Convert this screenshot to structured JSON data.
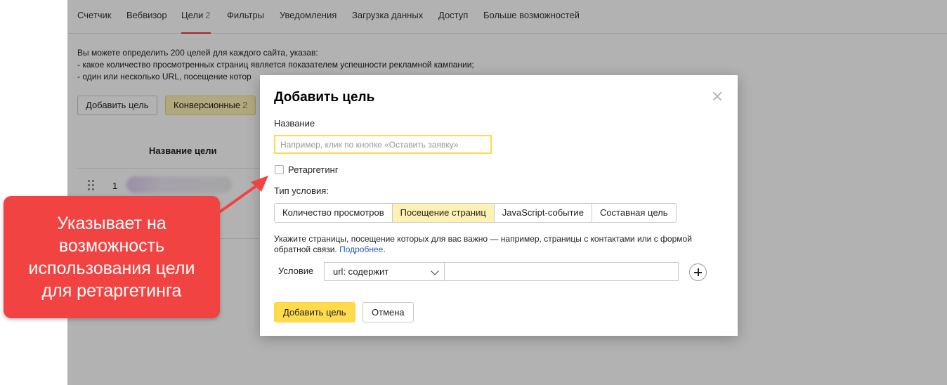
{
  "tabs": [
    {
      "label": "Счетчик"
    },
    {
      "label": "Вебвизор"
    },
    {
      "label": "Цели",
      "count": "2"
    },
    {
      "label": "Фильтры"
    },
    {
      "label": "Уведомления"
    },
    {
      "label": "Загрузка данных"
    },
    {
      "label": "Доступ"
    },
    {
      "label": "Больше возможностей"
    }
  ],
  "intro": {
    "line1": "Вы можете определить 200 целей для каждого сайта, указав:",
    "line2": "-  какое количество просмотренных страниц является показателем успешности рекламной кампании;",
    "line3": "-  один или несколько URL, посещение котор"
  },
  "page_buttons": {
    "add_goal": "Добавить цель",
    "conversion": "Конверсионные",
    "conversion_count": "2"
  },
  "table": {
    "header_name": "Название цели",
    "rows": [
      {
        "num": "1"
      }
    ]
  },
  "modal": {
    "title": "Добавить цель",
    "name_label": "Название",
    "name_placeholder": "Например, клик по кнопке «Оставить заявку»",
    "retargeting_label": "Ретаргетинг",
    "condition_type_label": "Тип условия:",
    "condition_types": [
      {
        "label": "Количество просмотров",
        "selected": false
      },
      {
        "label": "Посещение страниц",
        "selected": true
      },
      {
        "label": "JavaScript-событие",
        "selected": false
      },
      {
        "label": "Составная цель",
        "selected": false
      }
    ],
    "hint_text": "Укажите страницы, посещение которых для вас важно — например, страницы с контактами или с формой обратной связи.",
    "hint_link": "Подробнее",
    "hint_end": ".",
    "condition_label": "Условие",
    "condition_select": "url: содержит",
    "condition_value": "",
    "submit": "Добавить цель",
    "cancel": "Отмена"
  },
  "callout": {
    "text": "Указывает на\nвозможность\nиспользования цели\nдля ретаргетинга"
  },
  "colors": {
    "accent_yellow": "#ffdb4d",
    "selected_bg": "#fff1b3",
    "active_tab_underline": "#e63c31",
    "callout_bg": "#f24343",
    "link": "#2a5cb6"
  },
  "icons": [
    "close-icon",
    "checkbox-icon",
    "chevron-down-icon",
    "plus-icon",
    "drag-handle-icon",
    "arrow-annotation-icon"
  ]
}
